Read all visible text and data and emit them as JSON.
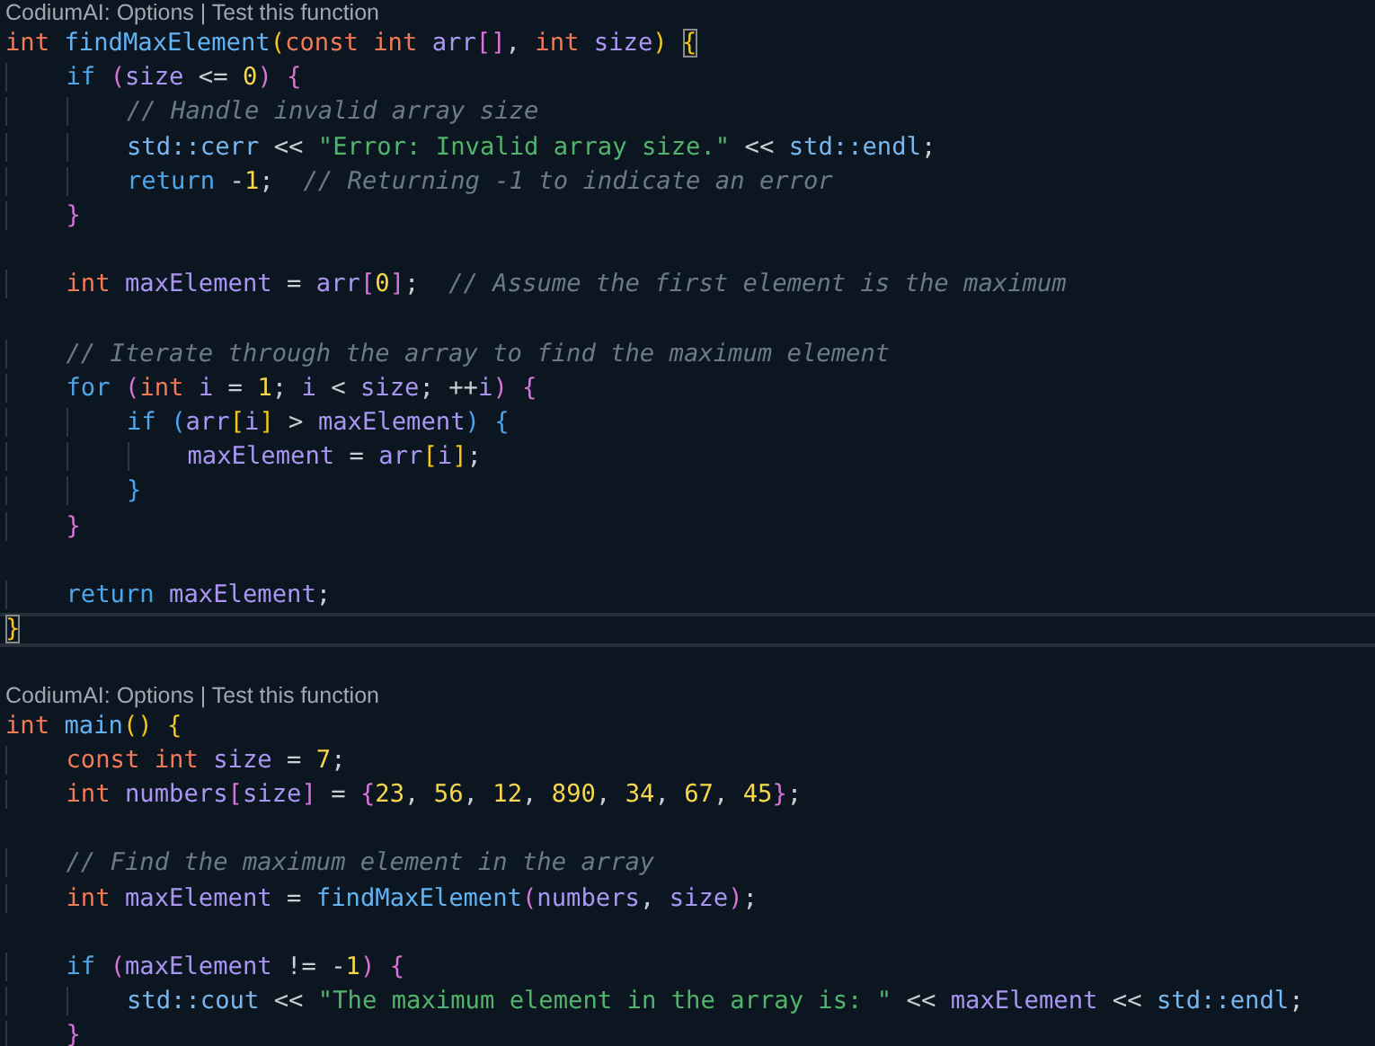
{
  "editor": {
    "blocks": [
      {
        "lens": "CodiumAI: Options | Test this function",
        "lines": [
          {
            "kind": "code",
            "current": false,
            "tokens": [
              {
                "kind": "type",
                "text": "int "
              },
              {
                "kind": "fn",
                "text": "findMaxElement"
              },
              {
                "kind": "b1",
                "text": "("
              },
              {
                "kind": "type",
                "text": "const int "
              },
              {
                "kind": "var",
                "text": "arr"
              },
              {
                "kind": "b2",
                "text": "[]"
              },
              {
                "kind": "op",
                "text": ", "
              },
              {
                "kind": "type",
                "text": "int "
              },
              {
                "kind": "var",
                "text": "size"
              },
              {
                "kind": "b1",
                "text": ") "
              },
              {
                "kind": "b1",
                "text": "{",
                "matched": true
              }
            ]
          },
          {
            "kind": "code",
            "current": false,
            "tokens": [
              {
                "kind": "kw",
                "text": "    if "
              },
              {
                "kind": "b2",
                "text": "("
              },
              {
                "kind": "var",
                "text": "size"
              },
              {
                "kind": "op",
                "text": " <= "
              },
              {
                "kind": "num",
                "text": "0"
              },
              {
                "kind": "b2",
                "text": ") {"
              }
            ]
          },
          {
            "kind": "code",
            "current": false,
            "tokens": [
              {
                "kind": "com",
                "text": "        // Handle invalid array size"
              }
            ]
          },
          {
            "kind": "code",
            "current": false,
            "tokens": [
              {
                "kind": "ns",
                "text": "        std::cerr"
              },
              {
                "kind": "op",
                "text": " << "
              },
              {
                "kind": "str",
                "text": "\"Error: Invalid array size.\""
              },
              {
                "kind": "op",
                "text": " << "
              },
              {
                "kind": "ns",
                "text": "std::endl"
              },
              {
                "kind": "op",
                "text": ";"
              }
            ]
          },
          {
            "kind": "code",
            "current": false,
            "tokens": [
              {
                "kind": "kw",
                "text": "        return"
              },
              {
                "kind": "op",
                "text": " -"
              },
              {
                "kind": "num",
                "text": "1"
              },
              {
                "kind": "op",
                "text": ";  "
              },
              {
                "kind": "com",
                "text": "// Returning -1 to indicate an error"
              }
            ]
          },
          {
            "kind": "code",
            "current": false,
            "tokens": [
              {
                "kind": "b2",
                "text": "    }"
              }
            ]
          },
          {
            "kind": "blank"
          },
          {
            "kind": "code",
            "current": false,
            "tokens": [
              {
                "kind": "type",
                "text": "    int "
              },
              {
                "kind": "var",
                "text": "maxElement"
              },
              {
                "kind": "op",
                "text": " = "
              },
              {
                "kind": "var",
                "text": "arr"
              },
              {
                "kind": "b2",
                "text": "["
              },
              {
                "kind": "num",
                "text": "0"
              },
              {
                "kind": "b2",
                "text": "]"
              },
              {
                "kind": "op",
                "text": ";  "
              },
              {
                "kind": "com",
                "text": "// Assume the first element is the maximum"
              }
            ]
          },
          {
            "kind": "blank"
          },
          {
            "kind": "code",
            "current": false,
            "tokens": [
              {
                "kind": "com",
                "text": "    // Iterate through the array to find the maximum element"
              }
            ]
          },
          {
            "kind": "code",
            "current": false,
            "tokens": [
              {
                "kind": "kw",
                "text": "    for "
              },
              {
                "kind": "b2",
                "text": "("
              },
              {
                "kind": "type",
                "text": "int "
              },
              {
                "kind": "var",
                "text": "i"
              },
              {
                "kind": "op",
                "text": " = "
              },
              {
                "kind": "num",
                "text": "1"
              },
              {
                "kind": "op",
                "text": "; "
              },
              {
                "kind": "var",
                "text": "i"
              },
              {
                "kind": "op",
                "text": " < "
              },
              {
                "kind": "var",
                "text": "size"
              },
              {
                "kind": "op",
                "text": "; ++"
              },
              {
                "kind": "var",
                "text": "i"
              },
              {
                "kind": "b2",
                "text": ") {"
              }
            ]
          },
          {
            "kind": "code",
            "current": false,
            "tokens": [
              {
                "kind": "kw",
                "text": "        if "
              },
              {
                "kind": "b3",
                "text": "("
              },
              {
                "kind": "var",
                "text": "arr"
              },
              {
                "kind": "b1",
                "text": "["
              },
              {
                "kind": "var",
                "text": "i"
              },
              {
                "kind": "b1",
                "text": "]"
              },
              {
                "kind": "op",
                "text": " > "
              },
              {
                "kind": "var",
                "text": "maxElement"
              },
              {
                "kind": "b3",
                "text": ") {"
              }
            ]
          },
          {
            "kind": "code",
            "current": false,
            "tokens": [
              {
                "kind": "var",
                "text": "            maxElement"
              },
              {
                "kind": "op",
                "text": " = "
              },
              {
                "kind": "var",
                "text": "arr"
              },
              {
                "kind": "b1",
                "text": "["
              },
              {
                "kind": "var",
                "text": "i"
              },
              {
                "kind": "b1",
                "text": "]"
              },
              {
                "kind": "op",
                "text": ";"
              }
            ]
          },
          {
            "kind": "code",
            "current": false,
            "tokens": [
              {
                "kind": "b3",
                "text": "        }"
              }
            ]
          },
          {
            "kind": "code",
            "current": false,
            "tokens": [
              {
                "kind": "b2",
                "text": "    }"
              }
            ]
          },
          {
            "kind": "blank"
          },
          {
            "kind": "code",
            "current": false,
            "tokens": [
              {
                "kind": "kw",
                "text": "    return "
              },
              {
                "kind": "var",
                "text": "maxElement"
              },
              {
                "kind": "op",
                "text": ";"
              }
            ]
          },
          {
            "kind": "code",
            "current": true,
            "tokens": [
              {
                "kind": "b1",
                "text": "}",
                "matched": true
              }
            ]
          },
          {
            "kind": "blank"
          }
        ]
      },
      {
        "lens": "CodiumAI: Options | Test this function",
        "lines": [
          {
            "kind": "code",
            "current": false,
            "tokens": [
              {
                "kind": "type",
                "text": "int "
              },
              {
                "kind": "fn",
                "text": "main"
              },
              {
                "kind": "b1",
                "text": "() {"
              }
            ]
          },
          {
            "kind": "code",
            "current": false,
            "tokens": [
              {
                "kind": "type",
                "text": "    const int "
              },
              {
                "kind": "var",
                "text": "size"
              },
              {
                "kind": "op",
                "text": " = "
              },
              {
                "kind": "num",
                "text": "7"
              },
              {
                "kind": "op",
                "text": ";"
              }
            ]
          },
          {
            "kind": "code",
            "current": false,
            "tokens": [
              {
                "kind": "type",
                "text": "    int "
              },
              {
                "kind": "var",
                "text": "numbers"
              },
              {
                "kind": "b2",
                "text": "["
              },
              {
                "kind": "var",
                "text": "size"
              },
              {
                "kind": "b2",
                "text": "]"
              },
              {
                "kind": "op",
                "text": " = "
              },
              {
                "kind": "b2",
                "text": "{"
              },
              {
                "kind": "num",
                "text": "23"
              },
              {
                "kind": "op",
                "text": ", "
              },
              {
                "kind": "num",
                "text": "56"
              },
              {
                "kind": "op",
                "text": ", "
              },
              {
                "kind": "num",
                "text": "12"
              },
              {
                "kind": "op",
                "text": ", "
              },
              {
                "kind": "num",
                "text": "890"
              },
              {
                "kind": "op",
                "text": ", "
              },
              {
                "kind": "num",
                "text": "34"
              },
              {
                "kind": "op",
                "text": ", "
              },
              {
                "kind": "num",
                "text": "67"
              },
              {
                "kind": "op",
                "text": ", "
              },
              {
                "kind": "num",
                "text": "45"
              },
              {
                "kind": "b2",
                "text": "}"
              },
              {
                "kind": "op",
                "text": ";"
              }
            ]
          },
          {
            "kind": "blank"
          },
          {
            "kind": "code",
            "current": false,
            "tokens": [
              {
                "kind": "com",
                "text": "    // Find the maximum element in the array"
              }
            ]
          },
          {
            "kind": "code",
            "current": false,
            "tokens": [
              {
                "kind": "type",
                "text": "    int "
              },
              {
                "kind": "var",
                "text": "maxElement"
              },
              {
                "kind": "op",
                "text": " = "
              },
              {
                "kind": "fn",
                "text": "findMaxElement"
              },
              {
                "kind": "b2",
                "text": "("
              },
              {
                "kind": "var",
                "text": "numbers"
              },
              {
                "kind": "op",
                "text": ", "
              },
              {
                "kind": "var",
                "text": "size"
              },
              {
                "kind": "b2",
                "text": ")"
              },
              {
                "kind": "op",
                "text": ";"
              }
            ]
          },
          {
            "kind": "blank"
          },
          {
            "kind": "code",
            "current": false,
            "tokens": [
              {
                "kind": "kw",
                "text": "    if "
              },
              {
                "kind": "b2",
                "text": "("
              },
              {
                "kind": "var",
                "text": "maxElement"
              },
              {
                "kind": "op",
                "text": " != -"
              },
              {
                "kind": "num",
                "text": "1"
              },
              {
                "kind": "b2",
                "text": ") {"
              }
            ]
          },
          {
            "kind": "code",
            "current": false,
            "tokens": [
              {
                "kind": "ns",
                "text": "        std::cout"
              },
              {
                "kind": "op",
                "text": " << "
              },
              {
                "kind": "str",
                "text": "\"The maximum element in the array is: \""
              },
              {
                "kind": "op",
                "text": " << "
              },
              {
                "kind": "var",
                "text": "maxElement"
              },
              {
                "kind": "op",
                "text": " << "
              },
              {
                "kind": "ns",
                "text": "std::endl"
              },
              {
                "kind": "op",
                "text": ";"
              }
            ]
          },
          {
            "kind": "code",
            "current": false,
            "tokens": [
              {
                "kind": "b2",
                "text": "    }"
              }
            ]
          }
        ]
      }
    ]
  }
}
